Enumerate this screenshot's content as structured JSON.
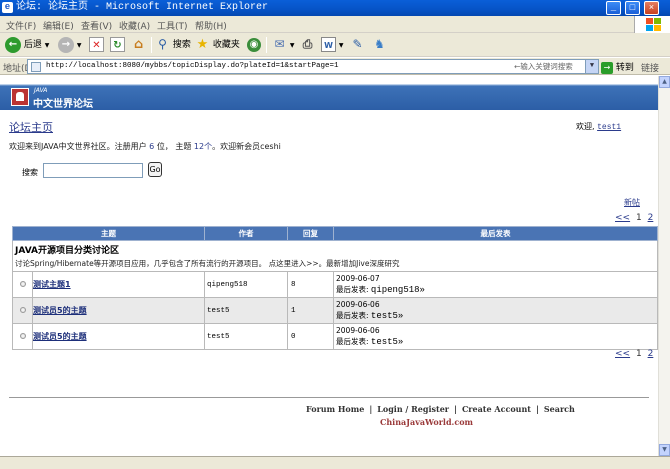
{
  "window": {
    "title": "论坛: 论坛主页 - Microsoft Internet Explorer",
    "minimize": "_",
    "maximize": "□",
    "close": "×"
  },
  "menu": [
    "文件(F)",
    "编辑(E)",
    "查看(V)",
    "收藏(A)",
    "工具(T)",
    "帮助(H)"
  ],
  "toolbar": {
    "back": "后退",
    "search": "搜索",
    "favorites": "收藏夹"
  },
  "address": {
    "label": "地址(D)",
    "url": "http://localhost:8080/mybbs/topicDisplay.do?plateId=1&startPage=1",
    "keyword_placeholder": "←输入关键词搜索",
    "go": "转到",
    "links": "链接"
  },
  "banner": {
    "sub": "JAVA",
    "name": "中文世界论坛"
  },
  "page": {
    "home_link": "论坛主页",
    "welcome_prefix": "欢迎,",
    "username": "test1",
    "stats_1": "欢迎来到JAVA中文世界社区。注册用户",
    "user_count": "6",
    "stats_2": "位， 主题",
    "topic_count": "12个",
    "stats_3": "。欢迎新会员ceshi",
    "search_label": "搜索",
    "search_value": "",
    "go_button": "Go",
    "new_post": "新帖"
  },
  "pager": {
    "prev": "<<",
    "pages": [
      "1",
      "2"
    ],
    "next": ">>"
  },
  "table": {
    "headers": [
      "主题",
      "作者",
      "回复",
      "最后发表"
    ],
    "category_title": "JAVA开源项目分类讨论区",
    "category_desc": "讨论Spring/Hibernate等开源项目应用，几乎包含了所有流行的开源项目。 点这里进入>>。最新增加Jive深度研究",
    "rows": [
      {
        "subject": "测试主题1",
        "author": "qipeng518",
        "replies": "8",
        "date": "2009-06-07",
        "last_prefix": "最后发表:",
        "last_user": "qipeng518»"
      },
      {
        "subject": "测试员5的主题",
        "author": "test5",
        "replies": "1",
        "date": "2009-06-06",
        "last_prefix": "最后发表:",
        "last_user": "test5»"
      },
      {
        "subject": "测试员5的主题",
        "author": "test5",
        "replies": "0",
        "date": "2009-06-06",
        "last_prefix": "最后发表:",
        "last_user": "test5»"
      }
    ]
  },
  "footer": {
    "links": [
      "Forum Home",
      "Login / Register",
      "Create Account",
      "Search"
    ],
    "separator": "|",
    "site": "ChinaJavaWorld.com"
  },
  "colors": {
    "header_blue": "#4a74b4",
    "link_blue": "#2b3b8c",
    "titlebar_blue": "#0653c6"
  }
}
